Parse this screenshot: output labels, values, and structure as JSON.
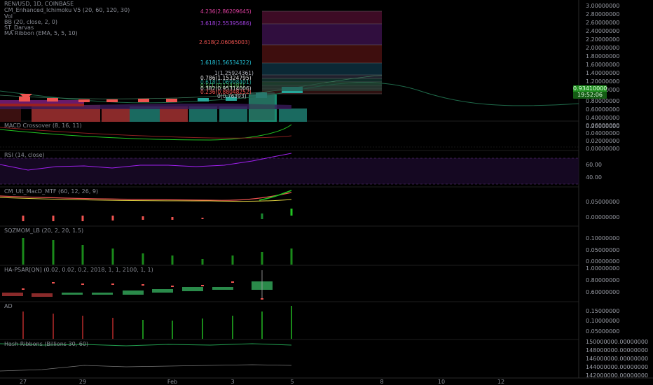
{
  "header": {
    "symbol_line": "REN/USD, 1D, COINBASE",
    "indicators": [
      "CM_Enhanced_Ichimoku V5 (20, 60, 120, 30)",
      "Vol",
      "BB (20, close, 2, 0)",
      "ST_Darvas",
      "MA Ribbon (EMA, 5, 5, 10)"
    ]
  },
  "colors": {
    "background": "#000000",
    "up": "#26a69a",
    "down": "#ef5350",
    "macd_up": "#22c522",
    "rsi": "#a020f0",
    "price_tag": "#1f8f1f"
  },
  "price_axis": {
    "labels": [
      "3.00000000",
      "2.80000000",
      "2.60000000",
      "2.40000000",
      "2.20000000",
      "2.00000000",
      "1.80000000",
      "1.60000000",
      "1.40000000",
      "1.20000000",
      "1.00000000",
      "0.80000000",
      "0.60000000",
      "0.40000000",
      "0.20000000"
    ],
    "last_price": "0.93410000",
    "countdown": "19:52:06"
  },
  "fib_levels": [
    {
      "label": "4.236(2.86209645)",
      "color": "#e040a0"
    },
    {
      "label": "3.618(2.55395686)",
      "color": "#a040e0"
    },
    {
      "label": "2.618(2.06065003)",
      "color": "#ef5350"
    },
    {
      "label": "1.618(1.56534322)",
      "color": "#26c6da"
    },
    {
      "label": "1(1.25924361)",
      "color": "#b2b5be"
    },
    {
      "label": "0.786(1.15324795)",
      "color": "#e0e0e0"
    },
    {
      "label": "0.618(1.06998401)",
      "color": "#26a69a"
    },
    {
      "label": "0.5(1.01124381)",
      "color": "#4caf50"
    },
    {
      "label": "0.382(0.95314006)",
      "color": "#e0e0e0"
    },
    {
      "label": "0.236(0.88048252)",
      "color": "#ef5350"
    },
    {
      "label": "0(0.76393)",
      "color": "#b2b5be"
    }
  ],
  "panes": {
    "macd": {
      "title": "MACD Crossover (8, 16, 11)",
      "axis": [
        "0.06000000",
        "0.04000000",
        "0.02000000",
        "0.00000000"
      ]
    },
    "rsi": {
      "title": "RSI (14, close)",
      "axis": [
        "60.00",
        "40.00"
      ]
    },
    "cm_macd": {
      "title": "CM_Ult_MacD_MTF (60, 12, 26, 9)",
      "axis": [
        "0.05000000",
        "0.00000000"
      ]
    },
    "sqzmom": {
      "title": "SQZMOM_LB (20, 2, 20, 1.5)",
      "axis": [
        "0.10000000",
        "0.05000000",
        "0.00000000"
      ]
    },
    "psar": {
      "title": "HA-PSAR[QN] (0.02, 0.02, 0.2, 2018, 1, 1, 2100, 1, 1)",
      "axis": [
        "1.00000000",
        "0.80000000",
        "0.60000000"
      ]
    },
    "ad": {
      "title": "AD",
      "axis": [
        "0.15000000",
        "0.10000000",
        "0.05000000"
      ]
    },
    "hash": {
      "title": "Hash Ribbons (Billions 30, 60)",
      "axis": [
        "150000000.00000000",
        "148000000.00000000",
        "146000000.00000000",
        "144000000.00000000",
        "142000000.00000000"
      ]
    }
  },
  "time_axis": {
    "labels": [
      "27",
      "29",
      "Feb",
      "3",
      "5",
      "8",
      "10",
      "12"
    ]
  }
}
